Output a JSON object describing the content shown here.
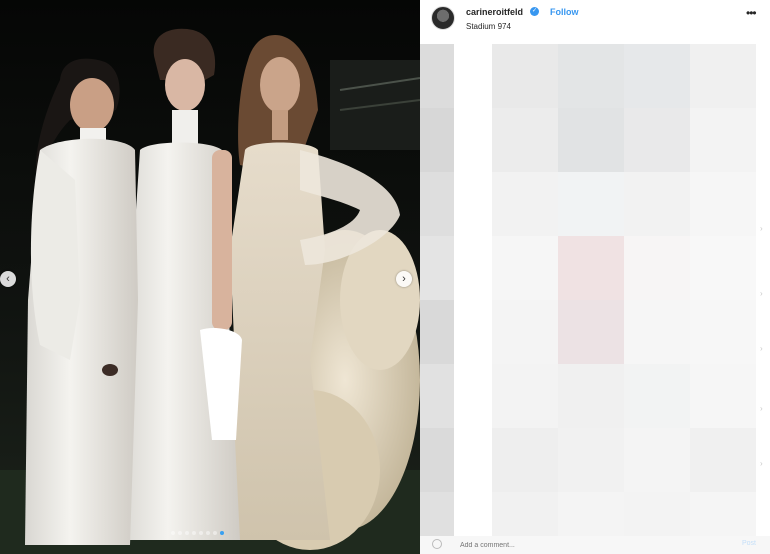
{
  "post": {
    "username": "carineroitfeld",
    "verified": true,
    "follow_label": "Follow",
    "location": "Stadium 974",
    "more_icon": "more-horizontal-icon",
    "more_label": "•••"
  },
  "carousel": {
    "prev_label": "‹",
    "next_label": "›",
    "slide_count": 8,
    "active_slide": 7
  },
  "comment": {
    "placeholder": "Add a comment...",
    "post_label": "Post"
  },
  "colors": {
    "photo_bg": "#0b0c0b",
    "follow": "#3897f0",
    "verified": "#3897f0"
  }
}
